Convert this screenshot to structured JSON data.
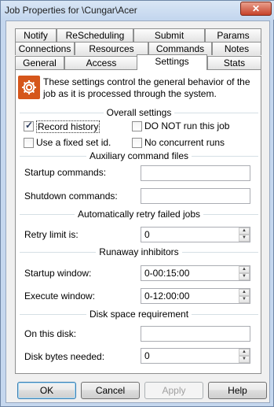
{
  "window": {
    "title": "Job Properties for \\Cungar\\Acer",
    "close_glyph": "✕"
  },
  "tabs": {
    "row1": [
      "Notify",
      "ReScheduling",
      "Submit",
      "Params"
    ],
    "row2": [
      "Connections",
      "Resources",
      "Commands",
      "Notes"
    ],
    "row3": [
      "General",
      "Access",
      "Settings",
      "Stats"
    ],
    "active": "Settings"
  },
  "info": {
    "icon": "gear-icon",
    "text": "These settings control the general behavior of the job as it is processed through the system."
  },
  "overall": {
    "title": "Overall settings",
    "record_history": {
      "label": "Record history",
      "checked": true
    },
    "do_not_run": {
      "label": "DO NOT run this job",
      "checked": false
    },
    "fixed_set_id": {
      "label": "Use a fixed set id.",
      "checked": false
    },
    "no_concurrent": {
      "label": "No concurrent runs",
      "checked": false
    }
  },
  "aux": {
    "title": "Auxiliary command files",
    "startup_label": "Startup commands:",
    "startup_value": "",
    "shutdown_label": "Shutdown commands:",
    "shutdown_value": ""
  },
  "retry": {
    "title": "Automatically retry failed jobs",
    "limit_label": "Retry limit is:",
    "limit_value": "0"
  },
  "runaway": {
    "title": "Runaway inhibitors",
    "startup_label": "Startup window:",
    "startup_value": "0-00:15:00",
    "execute_label": "Execute window:",
    "execute_value": "0-12:00:00"
  },
  "disk": {
    "title": "Disk space requirement",
    "on_disk_label": "On this disk:",
    "on_disk_value": "",
    "bytes_label": "Disk bytes needed:",
    "bytes_value": "0"
  },
  "buttons": {
    "ok": "OK",
    "cancel": "Cancel",
    "apply": "Apply",
    "help": "Help"
  }
}
